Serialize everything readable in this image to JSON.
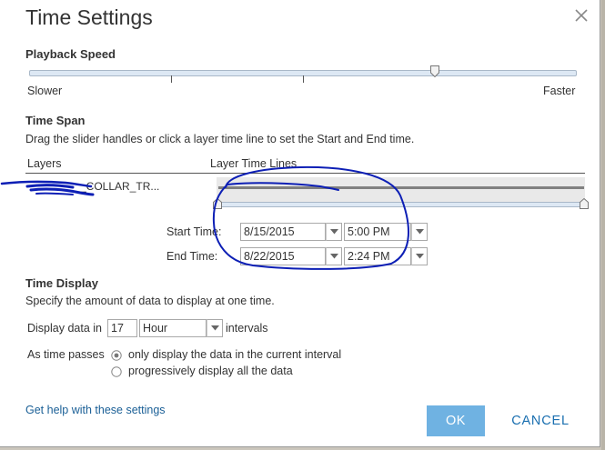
{
  "dialog": {
    "title": "Time Settings"
  },
  "playback": {
    "section_title": "Playback Speed",
    "slower_label": "Slower",
    "faster_label": "Faster",
    "speed_fraction": 0.75
  },
  "time_span": {
    "section_title": "Time Span",
    "instructions": "Drag the slider handles or click a layer time line to set the Start and End time.",
    "col_layers": "Layers",
    "col_timelines": "Layer Time Lines",
    "layer_name_visible": "_COLLAR_TR...",
    "start_label": "Start Time:",
    "start_date": "8/15/2015",
    "start_time": "5:00 PM",
    "end_label": "End Time:",
    "end_date": "8/22/2015",
    "end_time": "2:24 PM"
  },
  "time_display": {
    "section_title": "Time Display",
    "instructions": "Specify the amount of data to display at one time.",
    "display_prefix": "Display data in",
    "interval_value": "17",
    "interval_unit": "Hour",
    "display_suffix": "intervals",
    "as_time_passes": "As time passes",
    "option_current": "only display the data in the current interval",
    "option_progressive": "progressively display all the data",
    "selected_option": "current"
  },
  "footer": {
    "help_link": "Get help with these settings",
    "ok_label": "OK",
    "cancel_label": "CANCEL"
  },
  "colors": {
    "accent": "#6fb2e2",
    "link": "#1a5f96",
    "annotation_ink": "#0d1fb5"
  },
  "icons": {
    "close": "close-icon",
    "dropdown": "chevron-down-icon"
  }
}
